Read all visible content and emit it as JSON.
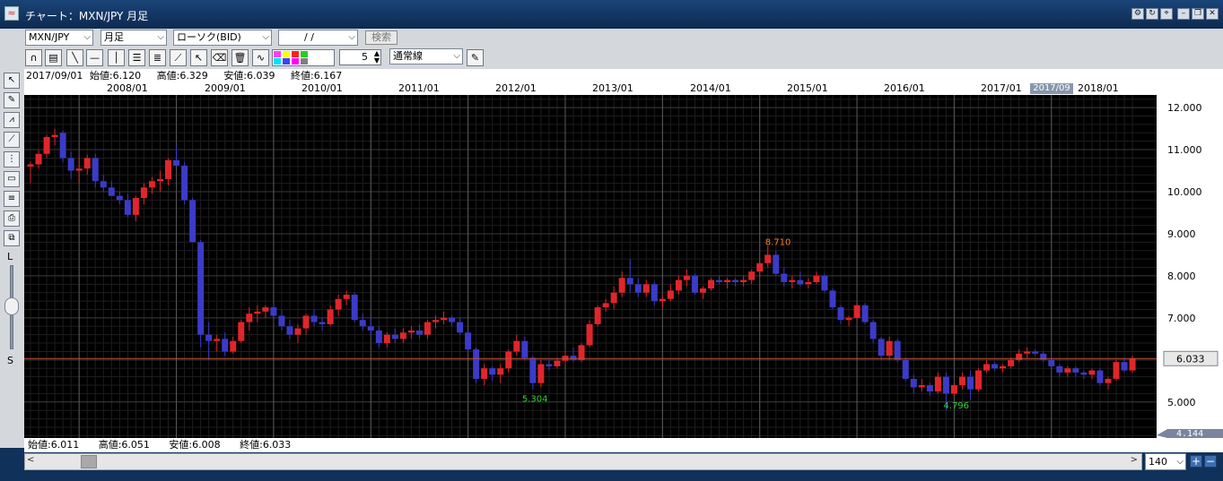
{
  "window": {
    "title": "チャート：MXN/JPY 月足",
    "icon": "app-icon",
    "buttons": [
      "gear-icon",
      "refresh-icon",
      "pin-icon",
      "minimize-icon",
      "restore-icon",
      "close-icon"
    ]
  },
  "toolbar": {
    "symbol": "MXN/JPY",
    "period": "月足",
    "chart_type": "ローソク(BID)",
    "date": "/ /",
    "search_label": "検索",
    "count": "5",
    "line_type": "通常線"
  },
  "info": {
    "top": {
      "date": "2017/09/01",
      "open": "始値:6.120",
      "high": "高値:6.329",
      "low": "安値:6.039",
      "close": "終値:6.167"
    },
    "bottom": {
      "open": "始値:6.011",
      "high": "高値:6.051",
      "low": "安値:6.008",
      "close": "終値:6.033"
    }
  },
  "year_labels": [
    "2008/01",
    "2009/01",
    "2010/01",
    "2011/01",
    "2012/01",
    "2013/01",
    "2014/01",
    "2015/01",
    "2016/01",
    "2017/01",
    "2018/01"
  ],
  "cursor_label": "2017/09",
  "side": {
    "L": "L",
    "S": "S"
  },
  "zoom": "140",
  "colors": {
    "up": "#e0262a",
    "down": "#3b3bc8",
    "grid": "#3a3a3a",
    "bg": "#000000",
    "price_line": "#c0503a"
  },
  "chart_data": {
    "type": "candlestick",
    "symbol": "MXN/JPY",
    "interval": "monthly",
    "start": "2007/07",
    "y_ticks": [
      "12.000",
      "11.000",
      "10.000",
      "9.000",
      "8.000",
      "7.000",
      "6.000",
      "5.000"
    ],
    "ylim": [
      4.144,
      12.3
    ],
    "current_price": "6.033",
    "bottom_price": "4.144",
    "annotations": [
      {
        "text": "8.710",
        "index": 92,
        "kind": "high"
      },
      {
        "text": "5.304",
        "index": 62,
        "kind": "low"
      },
      {
        "text": "4.796",
        "index": 114,
        "kind": "low"
      }
    ],
    "candles": [
      [
        10.6,
        10.72,
        10.2,
        10.65
      ],
      [
        10.65,
        10.98,
        10.55,
        10.9
      ],
      [
        10.9,
        11.35,
        10.8,
        11.3
      ],
      [
        11.3,
        11.5,
        11.1,
        11.35
      ],
      [
        11.4,
        11.45,
        10.7,
        10.8
      ],
      [
        10.8,
        10.95,
        10.3,
        10.5
      ],
      [
        10.5,
        10.82,
        10.2,
        10.55
      ],
      [
        10.55,
        10.88,
        10.4,
        10.8
      ],
      [
        10.8,
        10.9,
        10.1,
        10.25
      ],
      [
        10.25,
        10.4,
        10.0,
        10.1
      ],
      [
        10.1,
        10.25,
        9.9,
        9.9
      ],
      [
        9.9,
        10.0,
        9.7,
        9.8
      ],
      [
        9.8,
        9.95,
        9.4,
        9.45
      ],
      [
        9.45,
        9.9,
        9.3,
        9.85
      ],
      [
        9.85,
        10.2,
        9.7,
        10.1
      ],
      [
        10.1,
        10.35,
        9.95,
        10.25
      ],
      [
        10.25,
        10.5,
        10.0,
        10.3
      ],
      [
        10.3,
        10.8,
        10.15,
        10.75
      ],
      [
        10.75,
        11.1,
        10.6,
        10.62
      ],
      [
        10.62,
        10.7,
        9.7,
        9.8
      ],
      [
        9.8,
        9.85,
        8.8,
        8.8
      ],
      [
        8.8,
        8.85,
        6.3,
        6.6
      ],
      [
        6.6,
        6.9,
        6.0,
        6.45
      ],
      [
        6.45,
        6.6,
        6.2,
        6.5
      ],
      [
        6.5,
        6.65,
        6.1,
        6.2
      ],
      [
        6.2,
        6.55,
        6.15,
        6.45
      ],
      [
        6.45,
        6.95,
        6.4,
        6.9
      ],
      [
        6.9,
        7.25,
        6.7,
        7.1
      ],
      [
        7.1,
        7.3,
        6.9,
        7.15
      ],
      [
        7.15,
        7.3,
        7.0,
        7.25
      ],
      [
        7.25,
        7.35,
        6.95,
        7.05
      ],
      [
        7.05,
        7.2,
        6.7,
        6.8
      ],
      [
        6.8,
        6.95,
        6.5,
        6.6
      ],
      [
        6.6,
        6.85,
        6.4,
        6.75
      ],
      [
        6.75,
        7.1,
        6.6,
        7.05
      ],
      [
        7.05,
        7.2,
        6.8,
        6.9
      ],
      [
        6.9,
        7.0,
        6.7,
        6.85
      ],
      [
        6.85,
        7.3,
        6.8,
        7.2
      ],
      [
        7.2,
        7.55,
        7.05,
        7.45
      ],
      [
        7.45,
        7.65,
        7.3,
        7.55
      ],
      [
        7.55,
        7.6,
        6.9,
        6.95
      ],
      [
        6.95,
        7.1,
        6.7,
        6.8
      ],
      [
        6.8,
        7.0,
        6.6,
        6.7
      ],
      [
        6.7,
        6.8,
        6.3,
        6.4
      ],
      [
        6.4,
        6.65,
        6.3,
        6.6
      ],
      [
        6.6,
        6.75,
        6.4,
        6.5
      ],
      [
        6.5,
        6.75,
        6.4,
        6.65
      ],
      [
        6.65,
        6.8,
        6.5,
        6.7
      ],
      [
        6.7,
        6.85,
        6.5,
        6.6
      ],
      [
        6.6,
        6.95,
        6.5,
        6.9
      ],
      [
        6.9,
        7.05,
        6.75,
        6.95
      ],
      [
        6.95,
        7.15,
        6.85,
        7.0
      ],
      [
        7.0,
        7.05,
        6.8,
        6.9
      ],
      [
        6.9,
        7.0,
        6.6,
        6.65
      ],
      [
        6.65,
        6.7,
        6.2,
        6.25
      ],
      [
        6.25,
        6.3,
        5.45,
        5.55
      ],
      [
        5.55,
        5.9,
        5.4,
        5.8
      ],
      [
        5.8,
        5.85,
        5.5,
        5.65
      ],
      [
        5.65,
        5.9,
        5.45,
        5.8
      ],
      [
        5.8,
        6.25,
        5.7,
        6.2
      ],
      [
        6.2,
        6.6,
        6.1,
        6.45
      ],
      [
        6.45,
        6.55,
        6.0,
        6.05
      ],
      [
        6.05,
        6.1,
        5.3,
        5.45
      ],
      [
        5.45,
        6.0,
        5.35,
        5.9
      ],
      [
        5.9,
        6.0,
        5.75,
        5.85
      ],
      [
        5.85,
        6.05,
        5.8,
        5.98
      ],
      [
        5.98,
        6.2,
        5.9,
        6.1
      ],
      [
        6.1,
        6.3,
        5.95,
        6.0
      ],
      [
        6.0,
        6.4,
        5.95,
        6.35
      ],
      [
        6.35,
        6.95,
        6.3,
        6.85
      ],
      [
        6.85,
        7.3,
        6.8,
        7.25
      ],
      [
        7.25,
        7.45,
        7.15,
        7.35
      ],
      [
        7.35,
        7.75,
        7.2,
        7.6
      ],
      [
        7.6,
        8.1,
        7.5,
        7.95
      ],
      [
        7.95,
        8.4,
        7.6,
        7.8
      ],
      [
        7.8,
        7.95,
        7.5,
        7.6
      ],
      [
        7.6,
        7.9,
        7.5,
        7.8
      ],
      [
        7.8,
        7.85,
        7.3,
        7.4
      ],
      [
        7.4,
        7.55,
        7.25,
        7.45
      ],
      [
        7.45,
        7.8,
        7.4,
        7.65
      ],
      [
        7.65,
        8.0,
        7.55,
        7.9
      ],
      [
        7.9,
        8.15,
        7.75,
        8.0
      ],
      [
        8.0,
        8.05,
        7.55,
        7.6
      ],
      [
        7.6,
        7.75,
        7.45,
        7.7
      ],
      [
        7.7,
        7.95,
        7.65,
        7.9
      ],
      [
        7.9,
        8.0,
        7.8,
        7.85
      ],
      [
        7.85,
        7.95,
        7.7,
        7.9
      ],
      [
        7.9,
        7.95,
        7.75,
        7.85
      ],
      [
        7.85,
        8.0,
        7.75,
        7.9
      ],
      [
        7.9,
        8.15,
        7.8,
        8.1
      ],
      [
        8.1,
        8.35,
        8.0,
        8.3
      ],
      [
        8.3,
        8.71,
        8.2,
        8.5
      ],
      [
        8.5,
        8.6,
        8.0,
        8.05
      ],
      [
        8.05,
        8.2,
        7.75,
        7.85
      ],
      [
        7.85,
        8.0,
        7.7,
        7.9
      ],
      [
        7.9,
        8.1,
        7.75,
        7.8
      ],
      [
        7.8,
        7.95,
        7.7,
        7.85
      ],
      [
        7.85,
        8.1,
        7.8,
        8.0
      ],
      [
        8.0,
        8.05,
        7.6,
        7.65
      ],
      [
        7.65,
        7.7,
        7.2,
        7.25
      ],
      [
        7.25,
        7.3,
        6.85,
        6.95
      ],
      [
        6.95,
        7.05,
        6.8,
        7.0
      ],
      [
        7.0,
        7.35,
        6.95,
        7.3
      ],
      [
        7.3,
        7.35,
        6.85,
        6.9
      ],
      [
        6.9,
        6.95,
        6.4,
        6.5
      ],
      [
        6.5,
        6.55,
        6.0,
        6.1
      ],
      [
        6.1,
        6.55,
        6.0,
        6.45
      ],
      [
        6.45,
        6.5,
        5.95,
        6.0
      ],
      [
        6.0,
        6.05,
        5.5,
        5.55
      ],
      [
        5.55,
        5.65,
        5.2,
        5.35
      ],
      [
        5.35,
        5.55,
        5.25,
        5.4
      ],
      [
        5.4,
        5.45,
        5.15,
        5.25
      ],
      [
        5.25,
        5.7,
        5.2,
        5.6
      ],
      [
        5.6,
        5.7,
        4.8,
        5.2
      ],
      [
        5.2,
        5.45,
        5.15,
        5.4
      ],
      [
        5.4,
        5.7,
        5.3,
        5.6
      ],
      [
        5.6,
        5.75,
        5.05,
        5.3
      ],
      [
        5.3,
        5.8,
        5.25,
        5.75
      ],
      [
        5.75,
        6.0,
        5.7,
        5.9
      ],
      [
        5.9,
        5.95,
        5.75,
        5.8
      ],
      [
        5.8,
        5.9,
        5.7,
        5.85
      ],
      [
        5.85,
        6.05,
        5.8,
        6.0
      ],
      [
        6.0,
        6.25,
        5.95,
        6.15
      ],
      [
        6.15,
        6.3,
        6.05,
        6.2
      ],
      [
        6.2,
        6.25,
        6.1,
        6.15
      ],
      [
        6.15,
        6.2,
        5.95,
        6.0
      ],
      [
        6.0,
        6.05,
        5.8,
        5.85
      ],
      [
        5.85,
        5.9,
        5.6,
        5.7
      ],
      [
        5.7,
        5.85,
        5.6,
        5.8
      ],
      [
        5.8,
        5.85,
        5.6,
        5.7
      ],
      [
        5.7,
        5.75,
        5.55,
        5.65
      ],
      [
        5.65,
        5.8,
        5.55,
        5.75
      ],
      [
        5.75,
        5.8,
        5.4,
        5.45
      ],
      [
        5.45,
        5.6,
        5.3,
        5.55
      ],
      [
        5.55,
        6.0,
        5.5,
        5.95
      ],
      [
        5.95,
        6.05,
        5.7,
        5.75
      ],
      [
        5.75,
        6.1,
        5.7,
        6.03
      ]
    ]
  }
}
